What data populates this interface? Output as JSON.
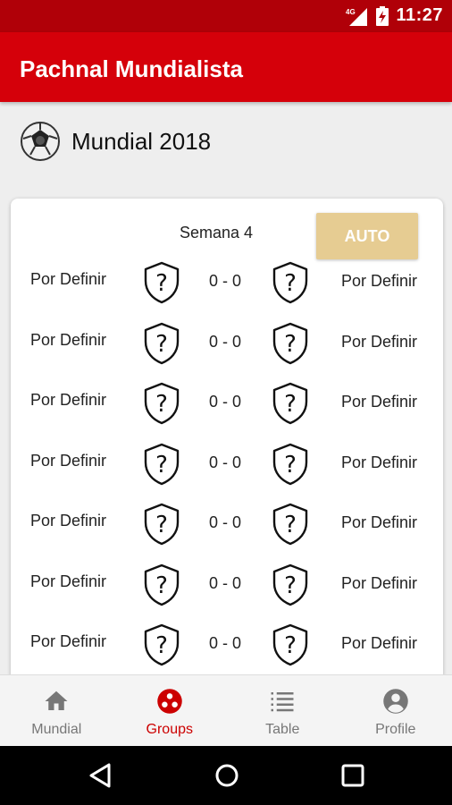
{
  "status_bar": {
    "time": "11:27",
    "network": "4G"
  },
  "app_bar": {
    "title": "Pachnal Mundialista"
  },
  "tournament": {
    "name": "Mundial 2018",
    "icon": "soccer-ball-icon"
  },
  "card": {
    "week": "Semana 4",
    "auto_label": "AUTO",
    "matches": [
      {
        "home": "Por Definir",
        "score": "0 - 0",
        "away": "Por Definir"
      },
      {
        "home": "Por Definir",
        "score": "0 - 0",
        "away": "Por Definir"
      },
      {
        "home": "Por Definir",
        "score": "0 - 0",
        "away": "Por Definir"
      },
      {
        "home": "Por Definir",
        "score": "0 - 0",
        "away": "Por Definir"
      },
      {
        "home": "Por Definir",
        "score": "0 - 0",
        "away": "Por Definir"
      },
      {
        "home": "Por Definir",
        "score": "0 - 0",
        "away": "Por Definir"
      },
      {
        "home": "Por Definir",
        "score": "0 - 0",
        "away": "Por Definir"
      }
    ]
  },
  "bottom_nav": {
    "items": [
      {
        "label": "Mundial",
        "icon": "home-icon"
      },
      {
        "label": "Groups",
        "icon": "groups-icon",
        "active": true
      },
      {
        "label": "Table",
        "icon": "list-icon"
      },
      {
        "label": "Profile",
        "icon": "account-icon"
      }
    ]
  },
  "colors": {
    "primary": "#d5000a",
    "status_bar": "#b00008",
    "auto_button": "#e6cc92",
    "active_nav": "#cc0000"
  }
}
